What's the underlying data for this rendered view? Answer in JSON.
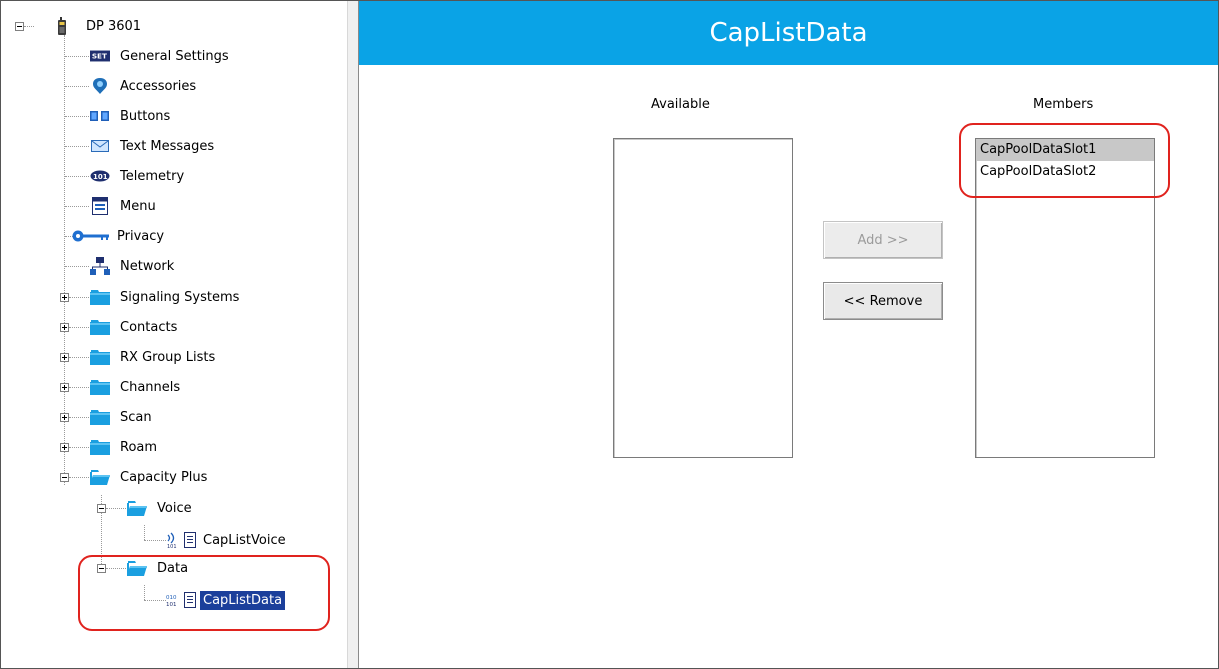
{
  "tree": {
    "root": {
      "label": "DP 3601",
      "icon": "radio-icon"
    },
    "items": [
      {
        "label": "General Settings",
        "icon": "set-icon"
      },
      {
        "label": "Accessories",
        "icon": "accessory-icon"
      },
      {
        "label": "Buttons",
        "icon": "buttons-icon"
      },
      {
        "label": "Text Messages",
        "icon": "envelope-icon"
      },
      {
        "label": "Telemetry",
        "icon": "telemetry-icon"
      },
      {
        "label": "Menu",
        "icon": "menu-icon"
      },
      {
        "label": "Privacy",
        "icon": "key-icon"
      },
      {
        "label": "Network",
        "icon": "network-icon"
      }
    ],
    "folders": [
      {
        "label": "Signaling Systems"
      },
      {
        "label": "Contacts"
      },
      {
        "label": "RX Group Lists"
      },
      {
        "label": "Channels"
      },
      {
        "label": "Scan"
      },
      {
        "label": "Roam"
      }
    ],
    "capacity_plus": {
      "label": "Capacity Plus",
      "voice": {
        "label": "Voice",
        "child": "CapListVoice"
      },
      "data": {
        "label": "Data",
        "child": "CapListData"
      }
    }
  },
  "content": {
    "title": "CapListData",
    "available_label": "Available",
    "members_label": "Members",
    "available_items": [],
    "members_items": [
      "CapPoolDataSlot1",
      "CapPoolDataSlot2"
    ],
    "add_button": "Add >>",
    "remove_button": "<< Remove"
  },
  "colors": {
    "title_bar": "#0aa3e6",
    "selection": "#1b3f9b",
    "highlight_ring": "#e0231e",
    "folder": "#1a9fe0"
  }
}
